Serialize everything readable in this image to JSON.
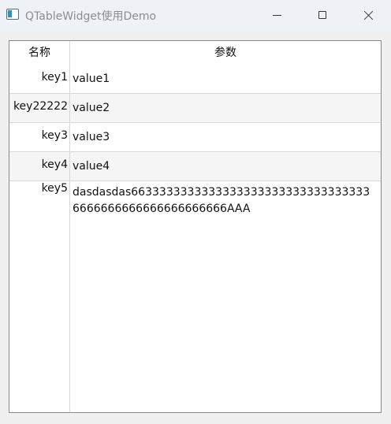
{
  "window": {
    "title": "QTableWidget使用Demo"
  },
  "table": {
    "headers": [
      "名称",
      "参数"
    ],
    "rows": [
      {
        "key": "key1",
        "value": "value1"
      },
      {
        "key": "key22222",
        "value": "value2"
      },
      {
        "key": "key3",
        "value": "value3"
      },
      {
        "key": "key4",
        "value": "value4"
      },
      {
        "key": "key5",
        "value": "dasdasdas66333333333333333333333333333333336666666666666666666666AAA"
      }
    ]
  }
}
